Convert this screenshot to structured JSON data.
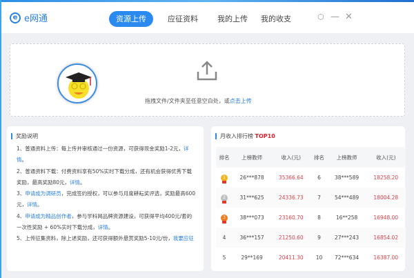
{
  "app": {
    "name": "e网通"
  },
  "tabs": [
    {
      "label": "资源上传",
      "active": true
    },
    {
      "label": "应征资料"
    },
    {
      "label": "我的上传"
    },
    {
      "label": "我的收支"
    }
  ],
  "upload": {
    "text": "拖拽文件/文件夹至任意空白处，或",
    "link": "点击上传"
  },
  "rewards": {
    "title": "奖励说明",
    "items": [
      {
        "prefix": "1、普通资料上传：每上传并审核通过一份资源，可获得现金奖励1-2元，",
        "link": "详情",
        "suffix": "。",
        "link2": "",
        "tail": ""
      },
      {
        "prefix": "2、普通资料下载：付费资料享有50%实时下载分成，还有机会获得优秀下载奖励，最高奖励80元，",
        "link": "详情",
        "suffix": "。"
      },
      {
        "prefix": "3、",
        "link": "申请成为调研员",
        "suffix": "，完成签约授权，可以参与月度耕耘奖评选，奖励最高600元，",
        "link2": "详情",
        "tail": "。"
      },
      {
        "prefix": "4、",
        "link": "申请成为精品创作者",
        "suffix": "，参与学科网品牌资源建设，可获得平均400元/套的一次性奖励 + 60%实时下载分成，",
        "link2": "详情",
        "tail": "。"
      },
      {
        "prefix": "5、上传征集资料，除上述奖励，还可获得额外悬赏奖励5-10元/份，",
        "link": "我要应征",
        "suffix": ""
      }
    ]
  },
  "ranking": {
    "title": "月收入排行榜",
    "badge": "TOP10",
    "headers": [
      "排名",
      "上榜教师",
      "收入(元)",
      "排名",
      "上榜教师",
      "收入(元)"
    ],
    "rows": [
      [
        "1",
        "26***878",
        "35366.64",
        "6",
        "38***589",
        "18258.20"
      ],
      [
        "2",
        "31***625",
        "24336.73",
        "7",
        "54***489",
        "18004.28"
      ],
      [
        "3",
        "38***073",
        "23160.70",
        "8",
        "16**258",
        "16948.00"
      ],
      [
        "4",
        "36***157",
        "21250.60",
        "9",
        "27***243",
        "16854.02"
      ],
      [
        "5",
        "29**169",
        "20411.30",
        "10",
        "72***634",
        "16387.00"
      ]
    ]
  },
  "colors": {
    "accent": "#2a8af0",
    "income": "#d9404a",
    "gold": "#f2b420",
    "silver": "#bfbfbf",
    "bronze": "#f07a1a"
  }
}
